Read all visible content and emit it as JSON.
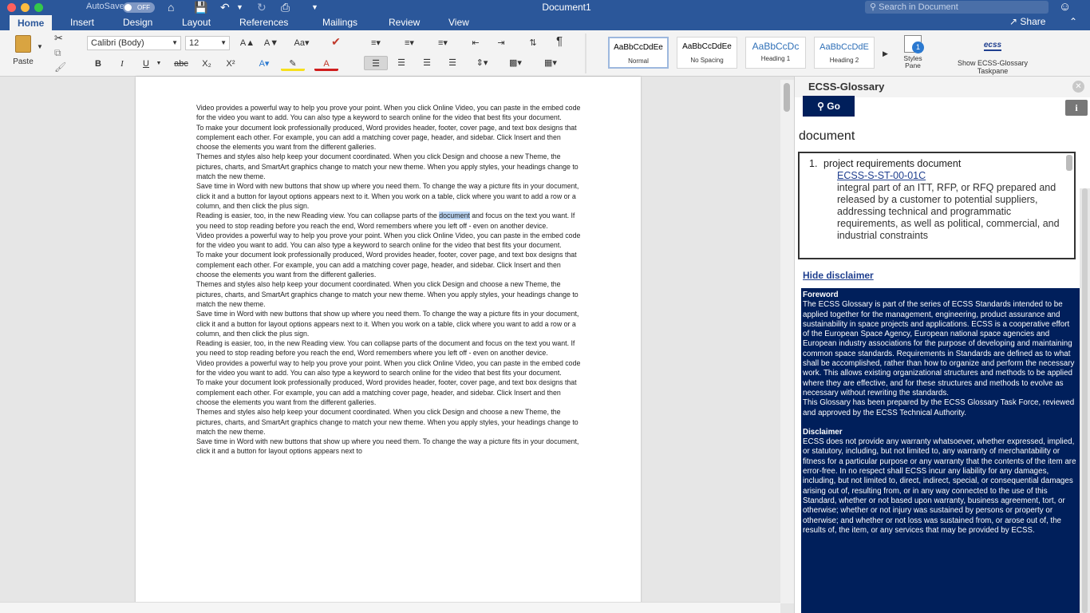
{
  "window": {
    "title": "Document1",
    "autosave_label": "AutoSave",
    "autosave_state": "OFF",
    "search_placeholder": "Search in Document"
  },
  "tabs": [
    "Home",
    "Insert",
    "Design",
    "Layout",
    "References",
    "Mailings",
    "Review",
    "View"
  ],
  "share_label": "Share",
  "ribbon": {
    "paste_label": "Paste",
    "font_name": "Calibri (Body)",
    "font_size": "12",
    "styles": [
      {
        "preview": "AaBbCcDdEe",
        "name": "Normal"
      },
      {
        "preview": "AaBbCcDdEe",
        "name": "No Spacing"
      },
      {
        "preview": "AaBbCcDc",
        "name": "Heading 1"
      },
      {
        "preview": "AaBbCcDdE",
        "name": "Heading 2"
      }
    ],
    "styles_pane_label": "Styles Pane",
    "styles_pane_badge": "1",
    "ecss_logo": "ecss",
    "ecss_button_label": "Show ECSS-Glossary Taskpane"
  },
  "document": {
    "highlighted_word": "document",
    "paragraphs": [
      "Video provides a powerful way to help you prove your point. When you click Online Video, you can paste in the embed code for the video you want to add. You can also type a keyword to search online for the video that best fits your document.",
      "To make your document look professionally produced, Word provides header, footer, cover page, and text box designs that complement each other. For example, you can add a matching cover page, header, and sidebar. Click Insert and then choose the elements you want from the different galleries.",
      "Themes and styles also help keep your document coordinated. When you click Design and choose a new Theme, the pictures, charts, and SmartArt graphics change to match your new theme. When you apply styles, your headings change to match the new theme.",
      "Save time in Word with new buttons that show up where you need them. To change the way a picture fits in your document, click it and a button for layout options appears next to it. When you work on a table, click where you want to add a row or a column, and then click the plus sign.",
      "Reading is easier, too, in the new Reading view. You can collapse parts of the document and focus on the text you want. If you need to stop reading before you reach the end, Word remembers where you left off - even on another device.",
      "Video provides a powerful way to help you prove your point. When you click Online Video, you can paste in the embed code for the video you want to add. You can also type a keyword to search online for the video that best fits your document.",
      "To make your document look professionally produced, Word provides header, footer, cover page, and text box designs that complement each other. For example, you can add a matching cover page, header, and sidebar. Click Insert and then choose the elements you want from the different galleries.",
      "Themes and styles also help keep your document coordinated. When you click Design and choose a new Theme, the pictures, charts, and SmartArt graphics change to match your new theme. When you apply styles, your headings change to match the new theme.",
      "Save time in Word with new buttons that show up where you need them. To change the way a picture fits in your document, click it and a button for layout options appears next to it. When you work on a table, click where you want to add a row or a column, and then click the plus sign.",
      "Reading is easier, too, in the new Reading view. You can collapse parts of the document and focus on the text you want. If you need to stop reading before you reach the end, Word remembers where you left off - even on another device.",
      "Video provides a powerful way to help you prove your point. When you click Online Video, you can paste in the embed code for the video you want to add. You can also type a keyword to search online for the video that best fits your document.",
      "To make your document look professionally produced, Word provides header, footer, cover page, and text box designs that complement each other. For example, you can add a matching cover page, header, and sidebar. Click Insert and then choose the elements you want from the different galleries.",
      "Themes and styles also help keep your document coordinated. When you click Design and choose a new Theme, the pictures, charts, and SmartArt graphics change to match your new theme. When you apply styles, your headings change to match the new theme.",
      "Save time in Word with new buttons that show up where you need them. To change the way a picture fits in your document, click it and a button for layout options appears next to"
    ]
  },
  "pane": {
    "title": "ECSS-Glossary",
    "go_label": "Go",
    "info_label": "i",
    "search_term": "document",
    "result": {
      "number": "1.",
      "term": "project requirements document",
      "source": "ECSS-S-ST-00-01C",
      "definition": "integral part of an ITT, RFP, or RFQ prepared and released by a customer to potential suppliers, addressing technical and programmatic requirements, as well as political, commercial, and industrial constraints"
    },
    "hide_disclaimer_label": "Hide disclaimer",
    "foreword_heading": "Foreword",
    "foreword_text": "The ECSS Glossary is part of the series of ECSS Standards intended to be applied together for the management, engineering, product assurance and sustainability in space projects and applications. ECSS is a cooperative effort of the European Space Agency, European national space agencies and European industry associations for the purpose of developing and maintaining common space standards. Requirements in Standards are defined as to what shall be accomplished, rather than how to organize and perform the necessary work. This allows existing organizational structures and methods to be applied where they are effective, and for these structures and methods to evolve as necessary without rewriting the standards.",
    "foreword_text2": "This Glossary has been prepared by the ECSS Glossary Task Force, reviewed and approved by the ECSS Technical Authority.",
    "disclaimer_heading": "Disclaimer",
    "disclaimer_text": "ECSS does not provide any warranty whatsoever, whether expressed, implied, or statutory, including, but not limited to, any warranty of merchantability or fitness for a particular purpose or any warranty that the contents of the item are error-free. In no respect shall ECSS incur any liability for any damages, including, but not limited to, direct, indirect, special, or consequential damages arising out of, resulting from, or in any way connected to the use of this Standard, whether or not based upon warranty, business agreement, tort, or otherwise; whether or not injury was sustained by persons or property or otherwise; and whether or not loss was sustained from, or arose out of, the results of, the item, or any services that may be provided by ECSS."
  },
  "colors": {
    "word_blue": "#2b579a",
    "ecss_navy": "#001f5b",
    "selection": "#b9d3f2"
  }
}
